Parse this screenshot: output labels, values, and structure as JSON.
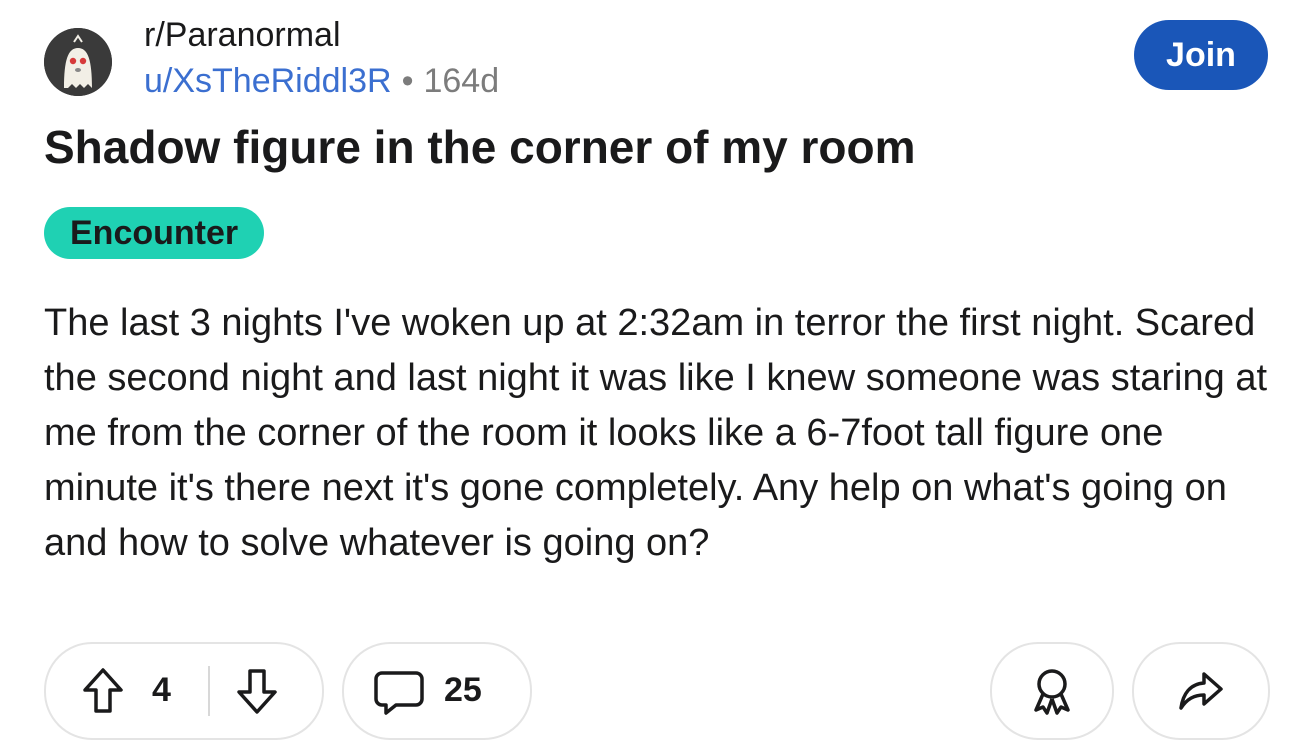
{
  "post": {
    "subreddit": "r/Paranormal",
    "username": "u/XsTheRiddl3R",
    "separator": "•",
    "age": "164d",
    "join_label": "Join",
    "title": "Shadow figure in the corner of my room",
    "flair": "Encounter",
    "body": "The last 3 nights I've woken up at 2:32am in terror the first night. Scared the second night and last night it was like I knew someone was staring at me from the corner of the room it looks like a 6-7foot tall figure one minute it's there next it's gone completely. Any help on what's going on and how to solve whatever is going on?"
  },
  "actions": {
    "vote_count": "4",
    "comment_count": "25"
  },
  "colors": {
    "accent": "#1a56b8",
    "flair_bg": "#1fd1b3",
    "username": "#3b6fd0",
    "muted": "#7c7c7c"
  },
  "icons": {
    "avatar": "subreddit-ghost-avatar",
    "upvote": "arrow-up-icon",
    "downvote": "arrow-down-icon",
    "comments": "speech-bubble-icon",
    "award": "award-icon",
    "share": "share-arrow-icon"
  }
}
